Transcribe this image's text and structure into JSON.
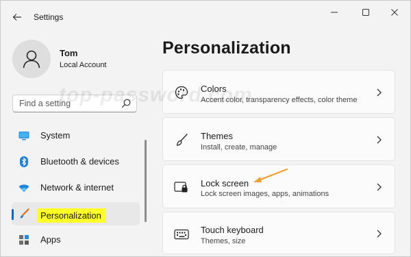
{
  "window": {
    "title": "Settings"
  },
  "icons": {
    "back": "back-arrow-icon",
    "minimize": "minimize-icon",
    "maximize": "maximize-icon",
    "close": "close-icon",
    "search": "search-icon",
    "avatar": "user-avatar-icon",
    "chevron": "chevron-right-icon"
  },
  "profile": {
    "name": "Tom",
    "account_type": "Local Account"
  },
  "search": {
    "placeholder": "Find a setting"
  },
  "sidebar": {
    "items": [
      {
        "label": "System",
        "icon": "monitor-icon",
        "selected": false
      },
      {
        "label": "Bluetooth & devices",
        "icon": "bluetooth-icon",
        "selected": false
      },
      {
        "label": "Network & internet",
        "icon": "wifi-icon",
        "selected": false
      },
      {
        "label": "Personalization",
        "icon": "paintbrush-icon",
        "selected": true,
        "highlighted": true
      },
      {
        "label": "Apps",
        "icon": "apps-icon",
        "selected": false
      }
    ]
  },
  "main": {
    "title": "Personalization",
    "cards": [
      {
        "title": "Colors",
        "subtitle": "Accent color, transparency effects, color theme",
        "icon": "palette-icon"
      },
      {
        "title": "Themes",
        "subtitle": "Install, create, manage",
        "icon": "brush-icon"
      },
      {
        "title": "Lock screen",
        "subtitle": "Lock screen images, apps, animations",
        "icon": "lock-screen-icon",
        "annotated": true
      },
      {
        "title": "Touch keyboard",
        "subtitle": "Themes, size",
        "icon": "keyboard-icon"
      }
    ]
  },
  "watermark": "top-password.com",
  "colors": {
    "accent": "#0067c0",
    "highlight": "#ffff2a",
    "annotation_arrow": "#f0a030"
  }
}
